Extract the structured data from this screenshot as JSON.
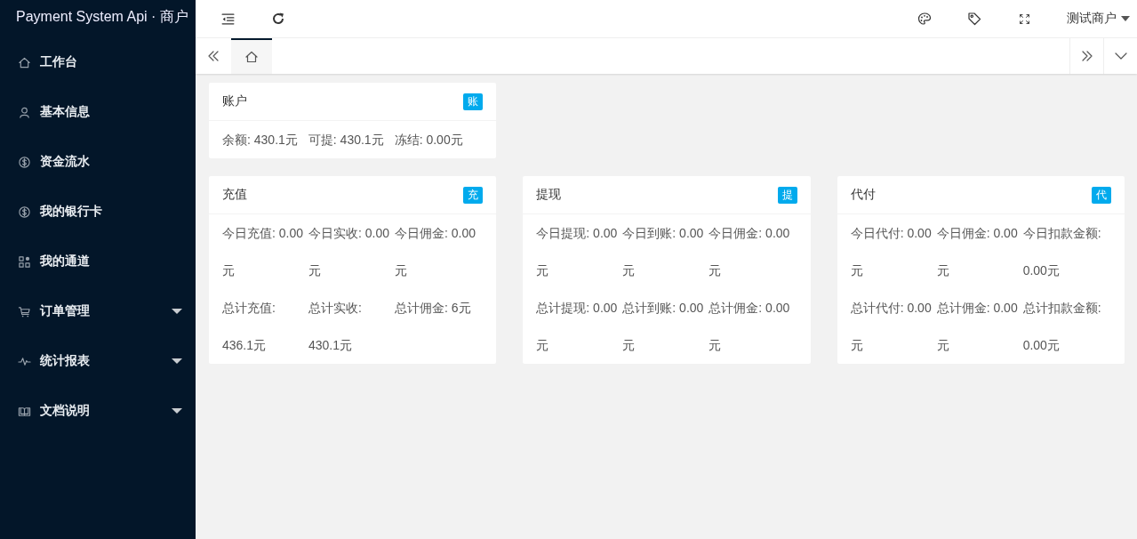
{
  "sidebar": {
    "logo": "Payment System Api · 商户",
    "items": [
      {
        "label": "工作台",
        "has_children": false
      },
      {
        "label": "基本信息",
        "has_children": false
      },
      {
        "label": "资金流水",
        "has_children": false
      },
      {
        "label": "我的银行卡",
        "has_children": false
      },
      {
        "label": "我的通道",
        "has_children": false
      },
      {
        "label": "订单管理",
        "has_children": true
      },
      {
        "label": "统计报表",
        "has_children": true
      },
      {
        "label": "文档说明",
        "has_children": true
      }
    ]
  },
  "header": {
    "user": "测试商户"
  },
  "tabs": [
    {
      "selected": true
    }
  ],
  "account_card": {
    "title": "账户",
    "badge": "账",
    "stats": [
      "余额: 430.1元",
      "可提: 430.1元",
      "冻结: 0.00元"
    ]
  },
  "cards": [
    {
      "title": "充值",
      "badge": "充",
      "stats": [
        "今日充值: 0.00元",
        "今日实收: 0.00元",
        "今日佣金: 0.00元",
        "总计充值: 436.1元",
        "总计实收: 430.1元",
        "总计佣金: 6元"
      ]
    },
    {
      "title": "提现",
      "badge": "提",
      "stats": [
        "今日提现: 0.00元",
        "今日到账: 0.00元",
        "今日佣金: 0.00元",
        "总计提现: 0.00元",
        "总计到账: 0.00元",
        "总计佣金: 0.00元"
      ]
    },
    {
      "title": "代付",
      "badge": "代",
      "stats": [
        "今日代付: 0.00元",
        "今日佣金: 0.00元",
        "今日扣款金额: 0.00元",
        "总计代付: 0.00元",
        "总计佣金: 0.00元",
        "总计扣款金额: 0.00元"
      ]
    }
  ]
}
